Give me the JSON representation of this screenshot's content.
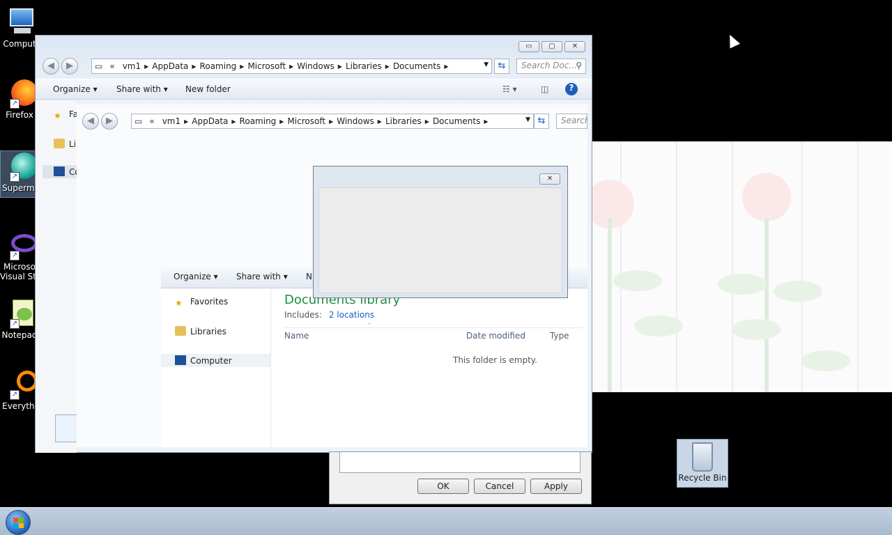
{
  "desktop": {
    "icons": [
      {
        "label": "Comput",
        "icon": "computer-icon"
      },
      {
        "label": "Firefox",
        "icon": "firefox-icon"
      },
      {
        "label": "Supermi",
        "icon": "supermium-icon"
      },
      {
        "label": "Microso",
        "label2": "Visual Stu",
        "icon": "visual-studio-icon"
      },
      {
        "label": "Notepad",
        "icon": "notepad-icon"
      },
      {
        "label": "Everythi",
        "icon": "everything-icon"
      }
    ],
    "recycle_bin": {
      "label": "Recycle Bin",
      "icon": "recycle-bin-icon"
    }
  },
  "explorer_back": {
    "title_buttons": {
      "minimize": "▭",
      "maximize": "▢",
      "close": "✕"
    },
    "breadcrumb": [
      "vm1",
      "AppData",
      "Roaming",
      "Microsoft",
      "Windows",
      "Libraries",
      "Documents"
    ],
    "search_placeholder": "Search Doc...",
    "toolbar": {
      "organize": "Organize",
      "share_with": "Share with",
      "new_folder": "New folder"
    },
    "nav": {
      "favorites": "Fav",
      "libraries": "Lib",
      "computer": "Co"
    }
  },
  "explorer_front": {
    "breadcrumb": [
      "vm1",
      "AppData",
      "Roaming",
      "Microsoft",
      "Windows",
      "Libraries",
      "Documents"
    ],
    "search_placeholder": "Search",
    "toolbar": {
      "organize": "Organize",
      "share_with": "Share with",
      "new_folder": "N"
    },
    "nav": {
      "favorites": "Favorites",
      "libraries": "Libraries",
      "computer": "Computer"
    },
    "library": {
      "title": "Documents library",
      "includes_label": "Includes:",
      "locations_link": "2 locations"
    },
    "columns": {
      "name": "Name",
      "date_modified": "Date modified",
      "type": "Type"
    },
    "empty_message": "This folder is empty."
  },
  "properties_dialog": {
    "ok": "OK",
    "cancel": "Cancel",
    "apply": "Apply"
  },
  "colors": {
    "library_title": "#1e8e3e",
    "link": "#1a5bc4",
    "wallpaper_flower": "#fbe9e9"
  }
}
